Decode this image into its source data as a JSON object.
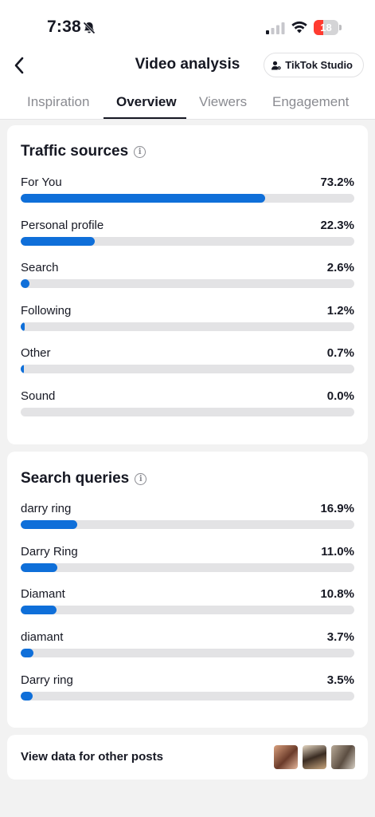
{
  "status": {
    "time": "7:38",
    "battery": "18",
    "battery_fraction": 0.18
  },
  "nav": {
    "title": "Video analysis",
    "studio_label": "TikTok Studio"
  },
  "tabs": [
    {
      "label": "Inspiration"
    },
    {
      "label": "Overview"
    },
    {
      "label": "Viewers"
    },
    {
      "label": "Engagement"
    }
  ],
  "traffic": {
    "title": "Traffic sources",
    "rows": [
      {
        "label": "For You",
        "value": "73.2%",
        "fraction": 0.732
      },
      {
        "label": "Personal profile",
        "value": "22.3%",
        "fraction": 0.223
      },
      {
        "label": "Search",
        "value": "2.6%",
        "fraction": 0.026
      },
      {
        "label": "Following",
        "value": "1.2%",
        "fraction": 0.012
      },
      {
        "label": "Other",
        "value": "0.7%",
        "fraction": 0.007
      },
      {
        "label": "Sound",
        "value": "0.0%",
        "fraction": 0.0
      }
    ]
  },
  "queries": {
    "title": "Search queries",
    "rows": [
      {
        "label": "darry ring",
        "value": "16.9%",
        "fraction": 0.169
      },
      {
        "label": "Darry Ring",
        "value": "11.0%",
        "fraction": 0.11
      },
      {
        "label": "Diamant",
        "value": "10.8%",
        "fraction": 0.108
      },
      {
        "label": "diamant",
        "value": "3.7%",
        "fraction": 0.037
      },
      {
        "label": "Darry ring",
        "value": "3.5%",
        "fraction": 0.035
      }
    ]
  },
  "other_posts": {
    "label": "View data for other posts"
  },
  "colors": {
    "bar": "#0f6fd9",
    "track": "#e3e3e5",
    "battery": "#ff3b30"
  }
}
